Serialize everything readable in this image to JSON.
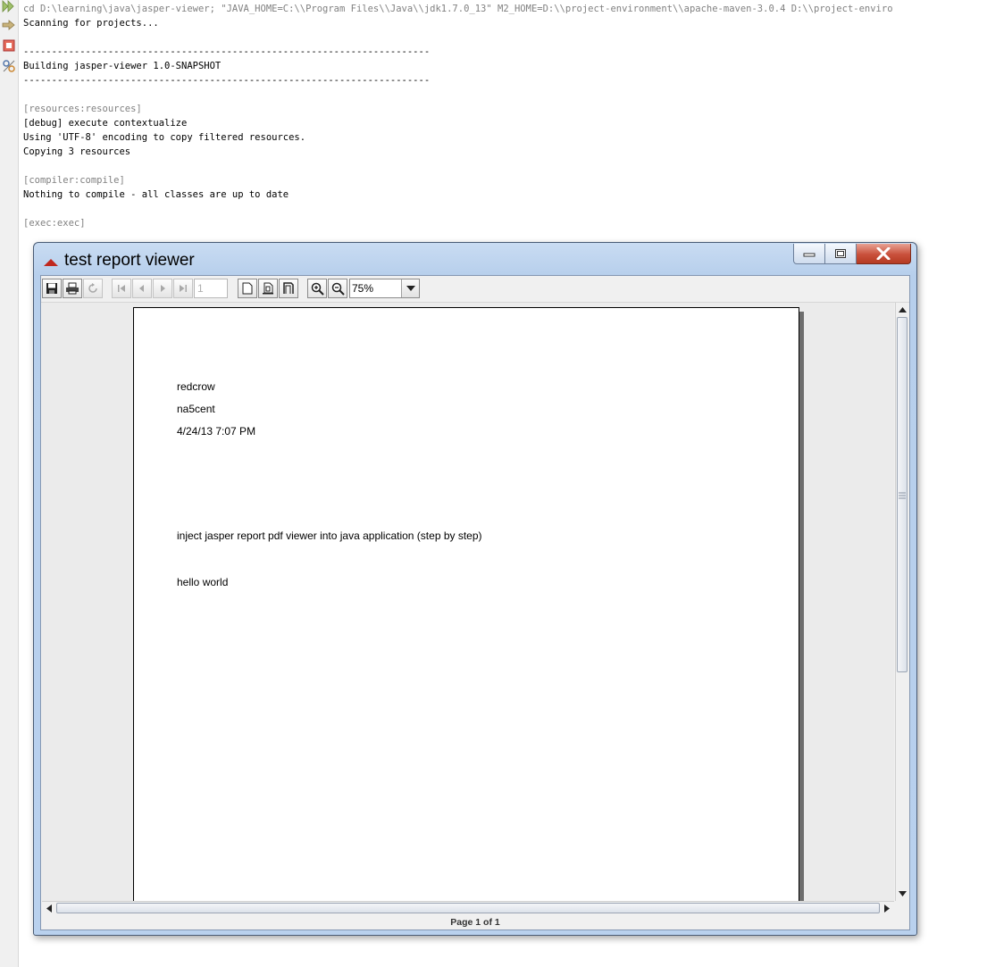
{
  "console": {
    "lines": [
      {
        "text": "cd D:\\learning\\java\\jasper-viewer; \"JAVA_HOME=C:\\\\Program Files\\\\Java\\\\jdk1.7.0_13\" M2_HOME=D:\\\\project-environment\\\\apache-maven-3.0.4 D:\\\\project-enviro",
        "muted": true
      },
      {
        "text": "Scanning for projects...",
        "muted": false
      },
      {
        "text": "",
        "muted": false
      },
      {
        "text": "------------------------------------------------------------------------",
        "muted": false
      },
      {
        "text": "Building jasper-viewer 1.0-SNAPSHOT",
        "muted": false
      },
      {
        "text": "------------------------------------------------------------------------",
        "muted": false
      },
      {
        "text": "",
        "muted": false
      },
      {
        "text": "[resources:resources]",
        "muted": true
      },
      {
        "text": "[debug] execute contextualize",
        "muted": false
      },
      {
        "text": "Using 'UTF-8' encoding to copy filtered resources.",
        "muted": false
      },
      {
        "text": "Copying 3 resources",
        "muted": false
      },
      {
        "text": "",
        "muted": false
      },
      {
        "text": "[compiler:compile]",
        "muted": true
      },
      {
        "text": "Nothing to compile - all classes are up to date",
        "muted": false
      },
      {
        "text": "",
        "muted": false
      },
      {
        "text": "[exec:exec]",
        "muted": true
      }
    ]
  },
  "window": {
    "title": "test report viewer"
  },
  "toolbar": {
    "page_number": "1",
    "zoom": "75%"
  },
  "report": {
    "author": "redcrow",
    "user": "na5cent",
    "datetime": "4/24/13 7:07 PM",
    "heading": "inject jasper report pdf viewer into java application (step by step)",
    "body": "hello world"
  },
  "status": {
    "page_info": "Page 1 of 1"
  },
  "colors": {
    "console_muted": "#808080",
    "titlebar": "#c9dcf2",
    "close_button": "#c9503b"
  }
}
